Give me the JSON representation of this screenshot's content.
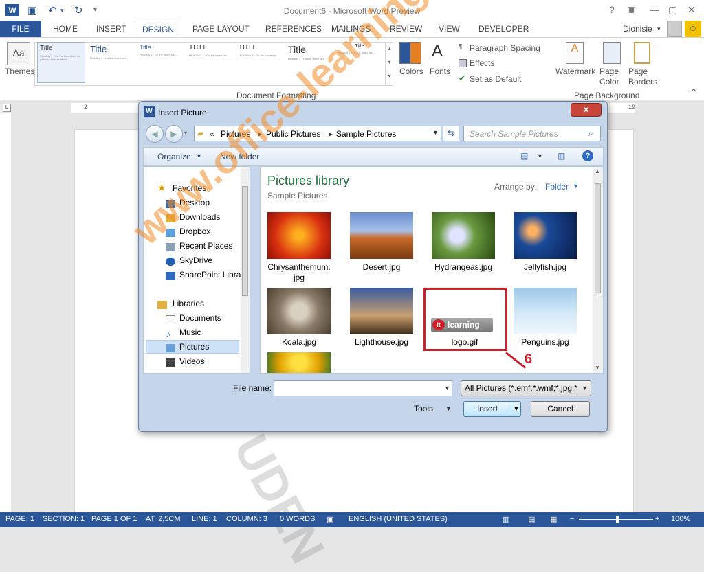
{
  "window": {
    "title": "Document6 - Microsoft Word Preview",
    "user": "Dionisie"
  },
  "tabs": [
    "FILE",
    "HOME",
    "INSERT",
    "DESIGN",
    "PAGE LAYOUT",
    "REFERENCES",
    "MAILINGS",
    "REVIEW",
    "VIEW",
    "DEVELOPER"
  ],
  "ribbon": {
    "themes": "Themes",
    "style_titles": [
      "Title",
      "Title",
      "Title",
      "TITLE",
      "TITLE",
      "Title",
      "Title"
    ],
    "colors": "Colors",
    "fonts": "Fonts",
    "paragraph_spacing": "Paragraph Spacing",
    "effects": "Effects",
    "set_default": "Set as Default",
    "doc_formatting": "Document Formatting",
    "watermark": "Watermark",
    "page_color": "Page Color",
    "page_borders": "Page Borders",
    "page_background": "Page Background"
  },
  "ruler": {
    "left": "2",
    "right": "19"
  },
  "dialog": {
    "title": "Insert Picture",
    "breadcrumb": [
      "Pictures",
      "Public Pictures",
      "Sample Pictures"
    ],
    "search_placeholder": "Search Sample Pictures",
    "organize": "Organize",
    "new_folder": "New folder",
    "library_title": "Pictures library",
    "library_sub": "Sample Pictures",
    "arrange_label": "Arrange by:",
    "arrange_value": "Folder",
    "nav": {
      "favorites": "Favorites",
      "fav_items": [
        "Desktop",
        "Downloads",
        "Dropbox",
        "Recent Places",
        "SkyDrive",
        "SharePoint Librar"
      ],
      "libraries": "Libraries",
      "lib_items": [
        "Documents",
        "Music",
        "Pictures",
        "Videos"
      ]
    },
    "files": [
      "Chrysanthemum.\njpg",
      "Desert.jpg",
      "Hydrangeas.jpg",
      "Jellyfish.jpg",
      "Koala.jpg",
      "Lighthouse.jpg",
      "logo.gif",
      "Penguins.jpg"
    ],
    "logo_text": "learning",
    "callout": "6",
    "file_name_label": "File name:",
    "file_name_value": "",
    "filter": "All Pictures (*.emf;*.wmf;*.jpg;*",
    "tools": "Tools",
    "insert": "Insert",
    "cancel": "Cancel"
  },
  "watermark": "www.office-learning.ro",
  "status": {
    "page": "PAGE: 1",
    "section": "SECTION: 1",
    "pageof": "PAGE 1 OF 1",
    "at": "AT: 2,5CM",
    "line": "LINE: 1",
    "column": "COLUMN: 3",
    "words": "0 WORDS",
    "lang": "ENGLISH (UNITED STATES)",
    "zoom": "100%"
  },
  "colors": {
    "accent": "#2b579a",
    "callout": "#d0202a"
  }
}
